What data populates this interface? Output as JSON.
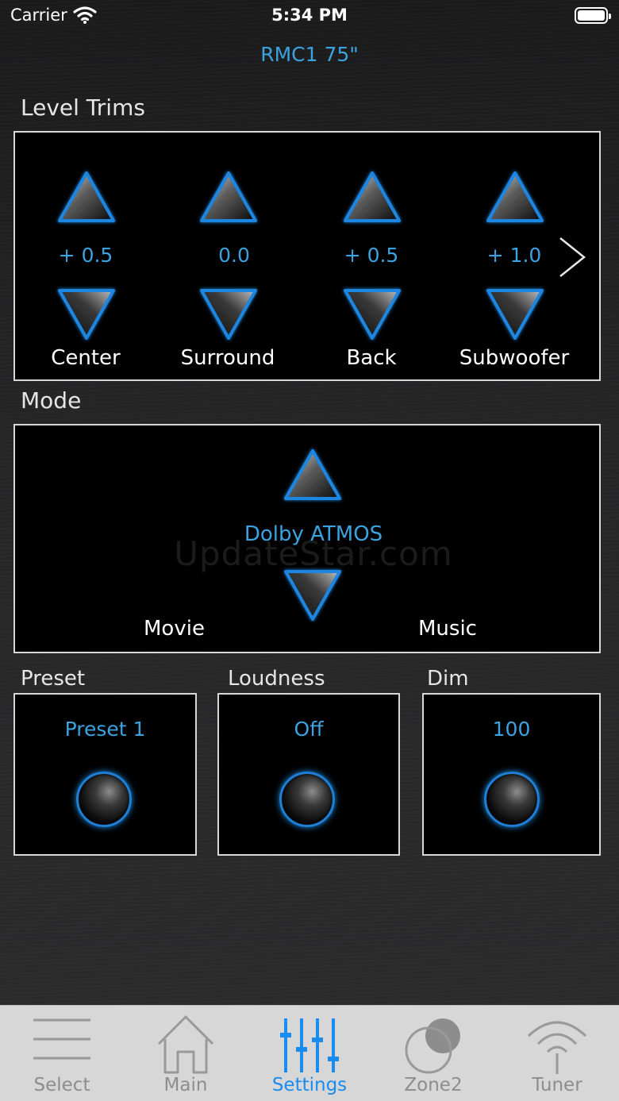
{
  "status_bar": {
    "carrier": "Carrier",
    "time": "5:34 PM"
  },
  "device": {
    "title": "RMC1 75\""
  },
  "level_trims": {
    "section_label": "Level Trims",
    "channels": [
      {
        "label": "Center",
        "value": "+ 0.5"
      },
      {
        "label": "Surround",
        "value": "0.0"
      },
      {
        "label": "Back",
        "value": "+ 0.5"
      },
      {
        "label": "Subwoofer",
        "value": "+ 1.0"
      }
    ],
    "next_icon": "chevron-right-icon"
  },
  "mode": {
    "section_label": "Mode",
    "value": "Dolby ATMOS",
    "left_label": "Movie",
    "right_label": "Music",
    "watermark": "UpdateStar.com"
  },
  "preset": {
    "section_label": "Preset",
    "value": "Preset 1"
  },
  "loudness": {
    "section_label": "Loudness",
    "value": "Off"
  },
  "dim": {
    "section_label": "Dim",
    "value": "100"
  },
  "tabs": [
    {
      "label": "Select",
      "icon": "list-icon",
      "active": false
    },
    {
      "label": "Main",
      "icon": "home-icon",
      "active": false
    },
    {
      "label": "Settings",
      "icon": "sliders-icon",
      "active": true
    },
    {
      "label": "Zone2",
      "icon": "zone-circles-icon",
      "active": false
    },
    {
      "label": "Tuner",
      "icon": "radio-signal-icon",
      "active": false
    }
  ],
  "colors": {
    "accent": "#3aa3e0",
    "active_tab": "#1a8cf0",
    "button_glow": "#1e8ee8",
    "panel_bg": "#000000",
    "tab_bar_bg": "#d7d7d7"
  }
}
